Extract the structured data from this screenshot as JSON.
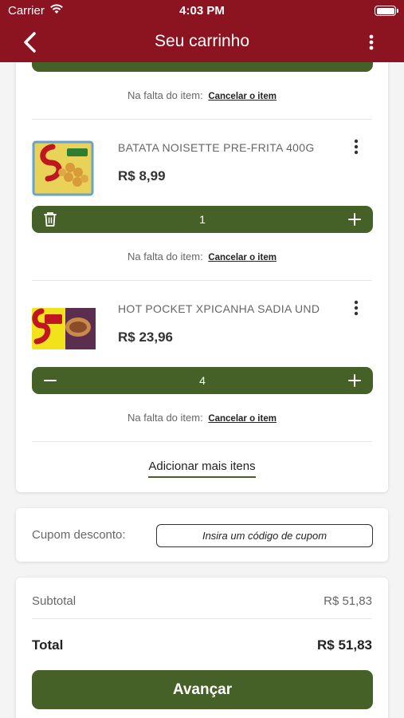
{
  "status_bar": {
    "carrier": "Carrier",
    "time": "4:03 PM"
  },
  "nav": {
    "title": "Seu carrinho"
  },
  "missing_item": {
    "label": "Na falta do item:",
    "action": "Cancelar o item"
  },
  "cart_items": [
    {
      "name": "BATATA NOISETTE PRE-FRITA 400G",
      "price": "R$ 8,99",
      "quantity": "1",
      "left_icon": "trash-icon",
      "right_icon": "plus-icon"
    },
    {
      "name": "HOT POCKET XPICANHA SADIA UND",
      "price": "R$ 23,96",
      "quantity": "4",
      "left_icon": "minus-icon",
      "right_icon": "plus-icon"
    }
  ],
  "add_more_label": "Adicionar mais itens",
  "coupon": {
    "label": "Cupom desconto:",
    "placeholder": "Insira um código de cupom"
  },
  "summary": {
    "subtotal_label": "Subtotal",
    "subtotal_value": "R$ 51,83",
    "total_label": "Total",
    "total_value": "R$ 51,83"
  },
  "advance_label": "Avançar",
  "colors": {
    "brand_red": "#8c1320",
    "brand_green": "#456128"
  }
}
